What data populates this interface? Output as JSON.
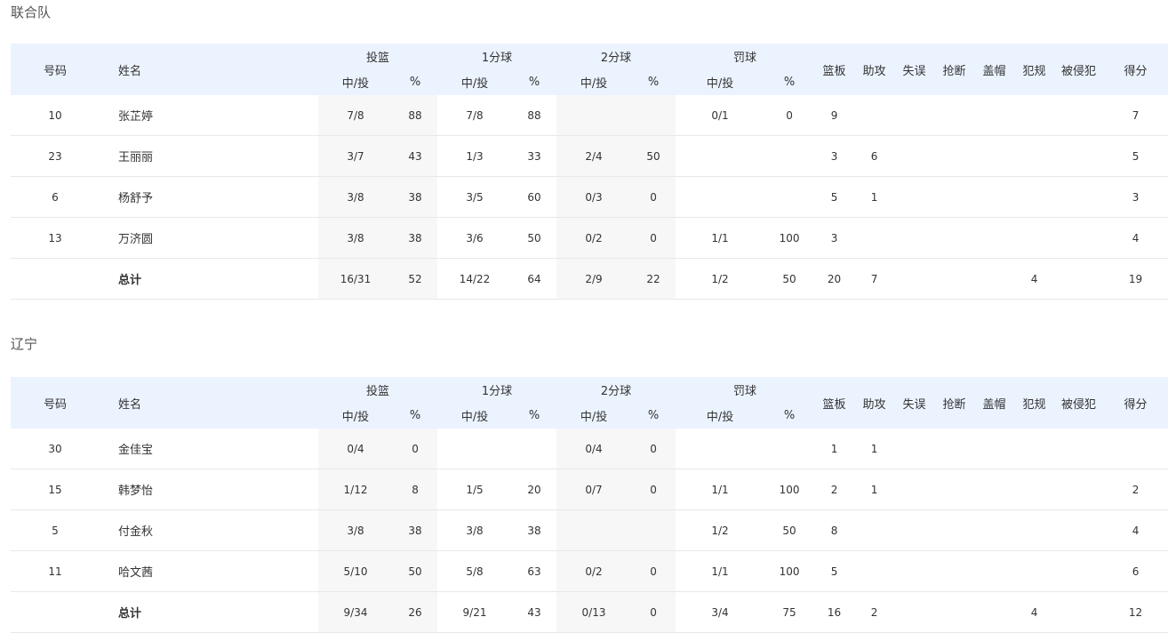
{
  "headers": {
    "number": "号码",
    "name": "姓名",
    "fg": "投篮",
    "one": "1分球",
    "two": "2分球",
    "ft": "罚球",
    "made_att": "中/投",
    "pct": "%",
    "reb": "篮板",
    "ast": "助攻",
    "tov": "失误",
    "stl": "抢断",
    "blk": "盖帽",
    "pf": "犯规",
    "fd": "被侵犯",
    "pts": "得分"
  },
  "teams": [
    {
      "name": "联合队",
      "rows": [
        {
          "no": "10",
          "name": "张芷婷",
          "fg_ma": "7/8",
          "fg_pct": "88",
          "one_ma": "7/8",
          "one_pct": "88",
          "two_ma": "",
          "two_pct": "",
          "ft_ma": "0/1",
          "ft_pct": "0",
          "reb": "9",
          "ast": "",
          "tov": "",
          "stl": "",
          "blk": "",
          "pf": "",
          "fd": "",
          "pts": "7"
        },
        {
          "no": "23",
          "name": "王丽丽",
          "fg_ma": "3/7",
          "fg_pct": "43",
          "one_ma": "1/3",
          "one_pct": "33",
          "two_ma": "2/4",
          "two_pct": "50",
          "ft_ma": "",
          "ft_pct": "",
          "reb": "3",
          "ast": "6",
          "tov": "",
          "stl": "",
          "blk": "",
          "pf": "",
          "fd": "",
          "pts": "5"
        },
        {
          "no": "6",
          "name": "杨舒予",
          "fg_ma": "3/8",
          "fg_pct": "38",
          "one_ma": "3/5",
          "one_pct": "60",
          "two_ma": "0/3",
          "two_pct": "0",
          "ft_ma": "",
          "ft_pct": "",
          "reb": "5",
          "ast": "1",
          "tov": "",
          "stl": "",
          "blk": "",
          "pf": "",
          "fd": "",
          "pts": "3"
        },
        {
          "no": "13",
          "name": "万济圆",
          "fg_ma": "3/8",
          "fg_pct": "38",
          "one_ma": "3/6",
          "one_pct": "50",
          "two_ma": "0/2",
          "two_pct": "0",
          "ft_ma": "1/1",
          "ft_pct": "100",
          "reb": "3",
          "ast": "",
          "tov": "",
          "stl": "",
          "blk": "",
          "pf": "",
          "fd": "",
          "pts": "4"
        }
      ],
      "total": {
        "no": "",
        "name": "总计",
        "fg_ma": "16/31",
        "fg_pct": "52",
        "one_ma": "14/22",
        "one_pct": "64",
        "two_ma": "2/9",
        "two_pct": "22",
        "ft_ma": "1/2",
        "ft_pct": "50",
        "reb": "20",
        "ast": "7",
        "tov": "",
        "stl": "",
        "blk": "",
        "pf": "4",
        "fd": "",
        "pts": "19"
      }
    },
    {
      "name": "辽宁",
      "rows": [
        {
          "no": "30",
          "name": "金佳宝",
          "fg_ma": "0/4",
          "fg_pct": "0",
          "one_ma": "",
          "one_pct": "",
          "two_ma": "0/4",
          "two_pct": "0",
          "ft_ma": "",
          "ft_pct": "",
          "reb": "1",
          "ast": "1",
          "tov": "",
          "stl": "",
          "blk": "",
          "pf": "",
          "fd": "",
          "pts": ""
        },
        {
          "no": "15",
          "name": "韩梦怡",
          "fg_ma": "1/12",
          "fg_pct": "8",
          "one_ma": "1/5",
          "one_pct": "20",
          "two_ma": "0/7",
          "two_pct": "0",
          "ft_ma": "1/1",
          "ft_pct": "100",
          "reb": "2",
          "ast": "1",
          "tov": "",
          "stl": "",
          "blk": "",
          "pf": "",
          "fd": "",
          "pts": "2"
        },
        {
          "no": "5",
          "name": "付金秋",
          "fg_ma": "3/8",
          "fg_pct": "38",
          "one_ma": "3/8",
          "one_pct": "38",
          "two_ma": "",
          "two_pct": "",
          "ft_ma": "1/2",
          "ft_pct": "50",
          "reb": "8",
          "ast": "",
          "tov": "",
          "stl": "",
          "blk": "",
          "pf": "",
          "fd": "",
          "pts": "4"
        },
        {
          "no": "11",
          "name": "哈文茜",
          "fg_ma": "5/10",
          "fg_pct": "50",
          "one_ma": "5/8",
          "one_pct": "63",
          "two_ma": "0/2",
          "two_pct": "0",
          "ft_ma": "1/1",
          "ft_pct": "100",
          "reb": "5",
          "ast": "",
          "tov": "",
          "stl": "",
          "blk": "",
          "pf": "",
          "fd": "",
          "pts": "6"
        }
      ],
      "total": {
        "no": "",
        "name": "总计",
        "fg_ma": "9/34",
        "fg_pct": "26",
        "one_ma": "9/21",
        "one_pct": "43",
        "two_ma": "0/13",
        "two_pct": "0",
        "ft_ma": "3/4",
        "ft_pct": "75",
        "reb": "16",
        "ast": "2",
        "tov": "",
        "stl": "",
        "blk": "",
        "pf": "4",
        "fd": "",
        "pts": "12"
      }
    }
  ]
}
